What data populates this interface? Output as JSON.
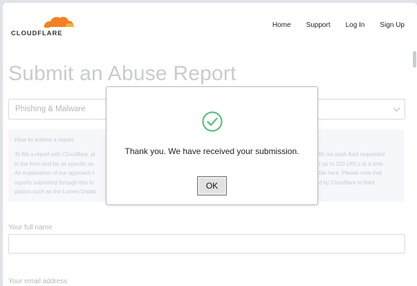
{
  "brand": {
    "name": "CLOUDFLARE",
    "accent": "#f38020",
    "accent_light": "#faad3f"
  },
  "nav": {
    "items": [
      "Home",
      "Support",
      "Log In",
      "Sign Up"
    ]
  },
  "page": {
    "title": "Submit an Abuse Report"
  },
  "report_type": {
    "selected": "Phishing & Malware"
  },
  "info": {
    "heading": "How to submit a report",
    "left_lines": [
      "To file a report with Cloudflare, pl",
      "in the form and be as specific as",
      "An explanation of our approach t",
      "reports submitted through this fo",
      "parties such as the Lumen Datab"
    ],
    "right_lines": [
      "fill out each field requested",
      "t up to 250 URLs at a time.",
      "ble here. Please note that",
      "d by Cloudflare to third",
      ""
    ]
  },
  "form": {
    "full_name_label": "Your full name",
    "email_label": "Your email address"
  },
  "dialog": {
    "message": "Thank you. We have received your submission.",
    "ok_label": "OK",
    "icon": "check-circle-icon",
    "icon_color": "#5cc07c"
  }
}
